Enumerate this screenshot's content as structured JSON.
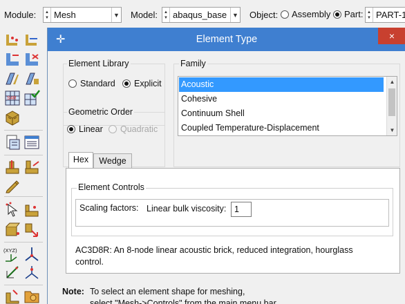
{
  "context_bar": {
    "module_label": "Module:",
    "module_value": "Mesh",
    "model_label": "Model:",
    "model_value": "abaqus_base",
    "object_label": "Object:",
    "assembly_label": "Assembly",
    "part_label": "Part:",
    "part_value": "PART-1",
    "object_selected": "Part"
  },
  "toolbox": {
    "icons": [
      "seed-part-icon",
      "seed-edge-icon",
      "seed-bias-icon",
      "seed-delete-icon",
      "mesh-controls-icon",
      "element-type-icon",
      "mesh-part-icon",
      "assign-element-type-icon",
      "mesh-region-icon",
      "verify-mesh-icon",
      "partition-icon",
      "partition-cell-icon",
      "virtual-topology-icon",
      "edit-mesh-icon",
      "query-icon",
      "create-node-icon",
      "edit-node-icon",
      "mesh-orientation-icon",
      "datum-csys-icon",
      "create-csys-icon",
      "datum-axis-icon",
      "datum-point-icon",
      "tools-icon",
      "part-library-icon"
    ],
    "datum_icon_text": "(XYZ)"
  },
  "dialog": {
    "title": "Element Type",
    "close_glyph": "×",
    "element_library": {
      "label": "Element Library",
      "options": [
        "Standard",
        "Explicit"
      ],
      "selected": "Explicit"
    },
    "geometric_order": {
      "label": "Geometric Order",
      "options": [
        "Linear",
        "Quadratic"
      ],
      "selected": "Linear",
      "disabled": [
        "Quadratic"
      ]
    },
    "family": {
      "label": "Family",
      "items": [
        "Acoustic",
        "Cohesive",
        "Continuum Shell",
        "Coupled Temperature-Displacement"
      ],
      "selected": "Acoustic"
    },
    "tabs": [
      "Hex",
      "Wedge"
    ],
    "active_tab": "Hex",
    "element_controls": {
      "label": "Element Controls",
      "scaling_label": "Scaling factors:",
      "viscosity_label": "Linear bulk viscosity:",
      "viscosity_value": "1"
    },
    "description": "AC3D8R:  An 8-node linear acoustic brick, reduced integration, hourglass control.",
    "note_label": "Note:",
    "note_text": "To select an element shape for meshing,",
    "note_text_2": "select \"Mesh->Controls\" from the main menu bar."
  },
  "colors": {
    "title_bar": "#3f7fd0",
    "close_button": "#c8402f",
    "selection": "#3399ff"
  }
}
